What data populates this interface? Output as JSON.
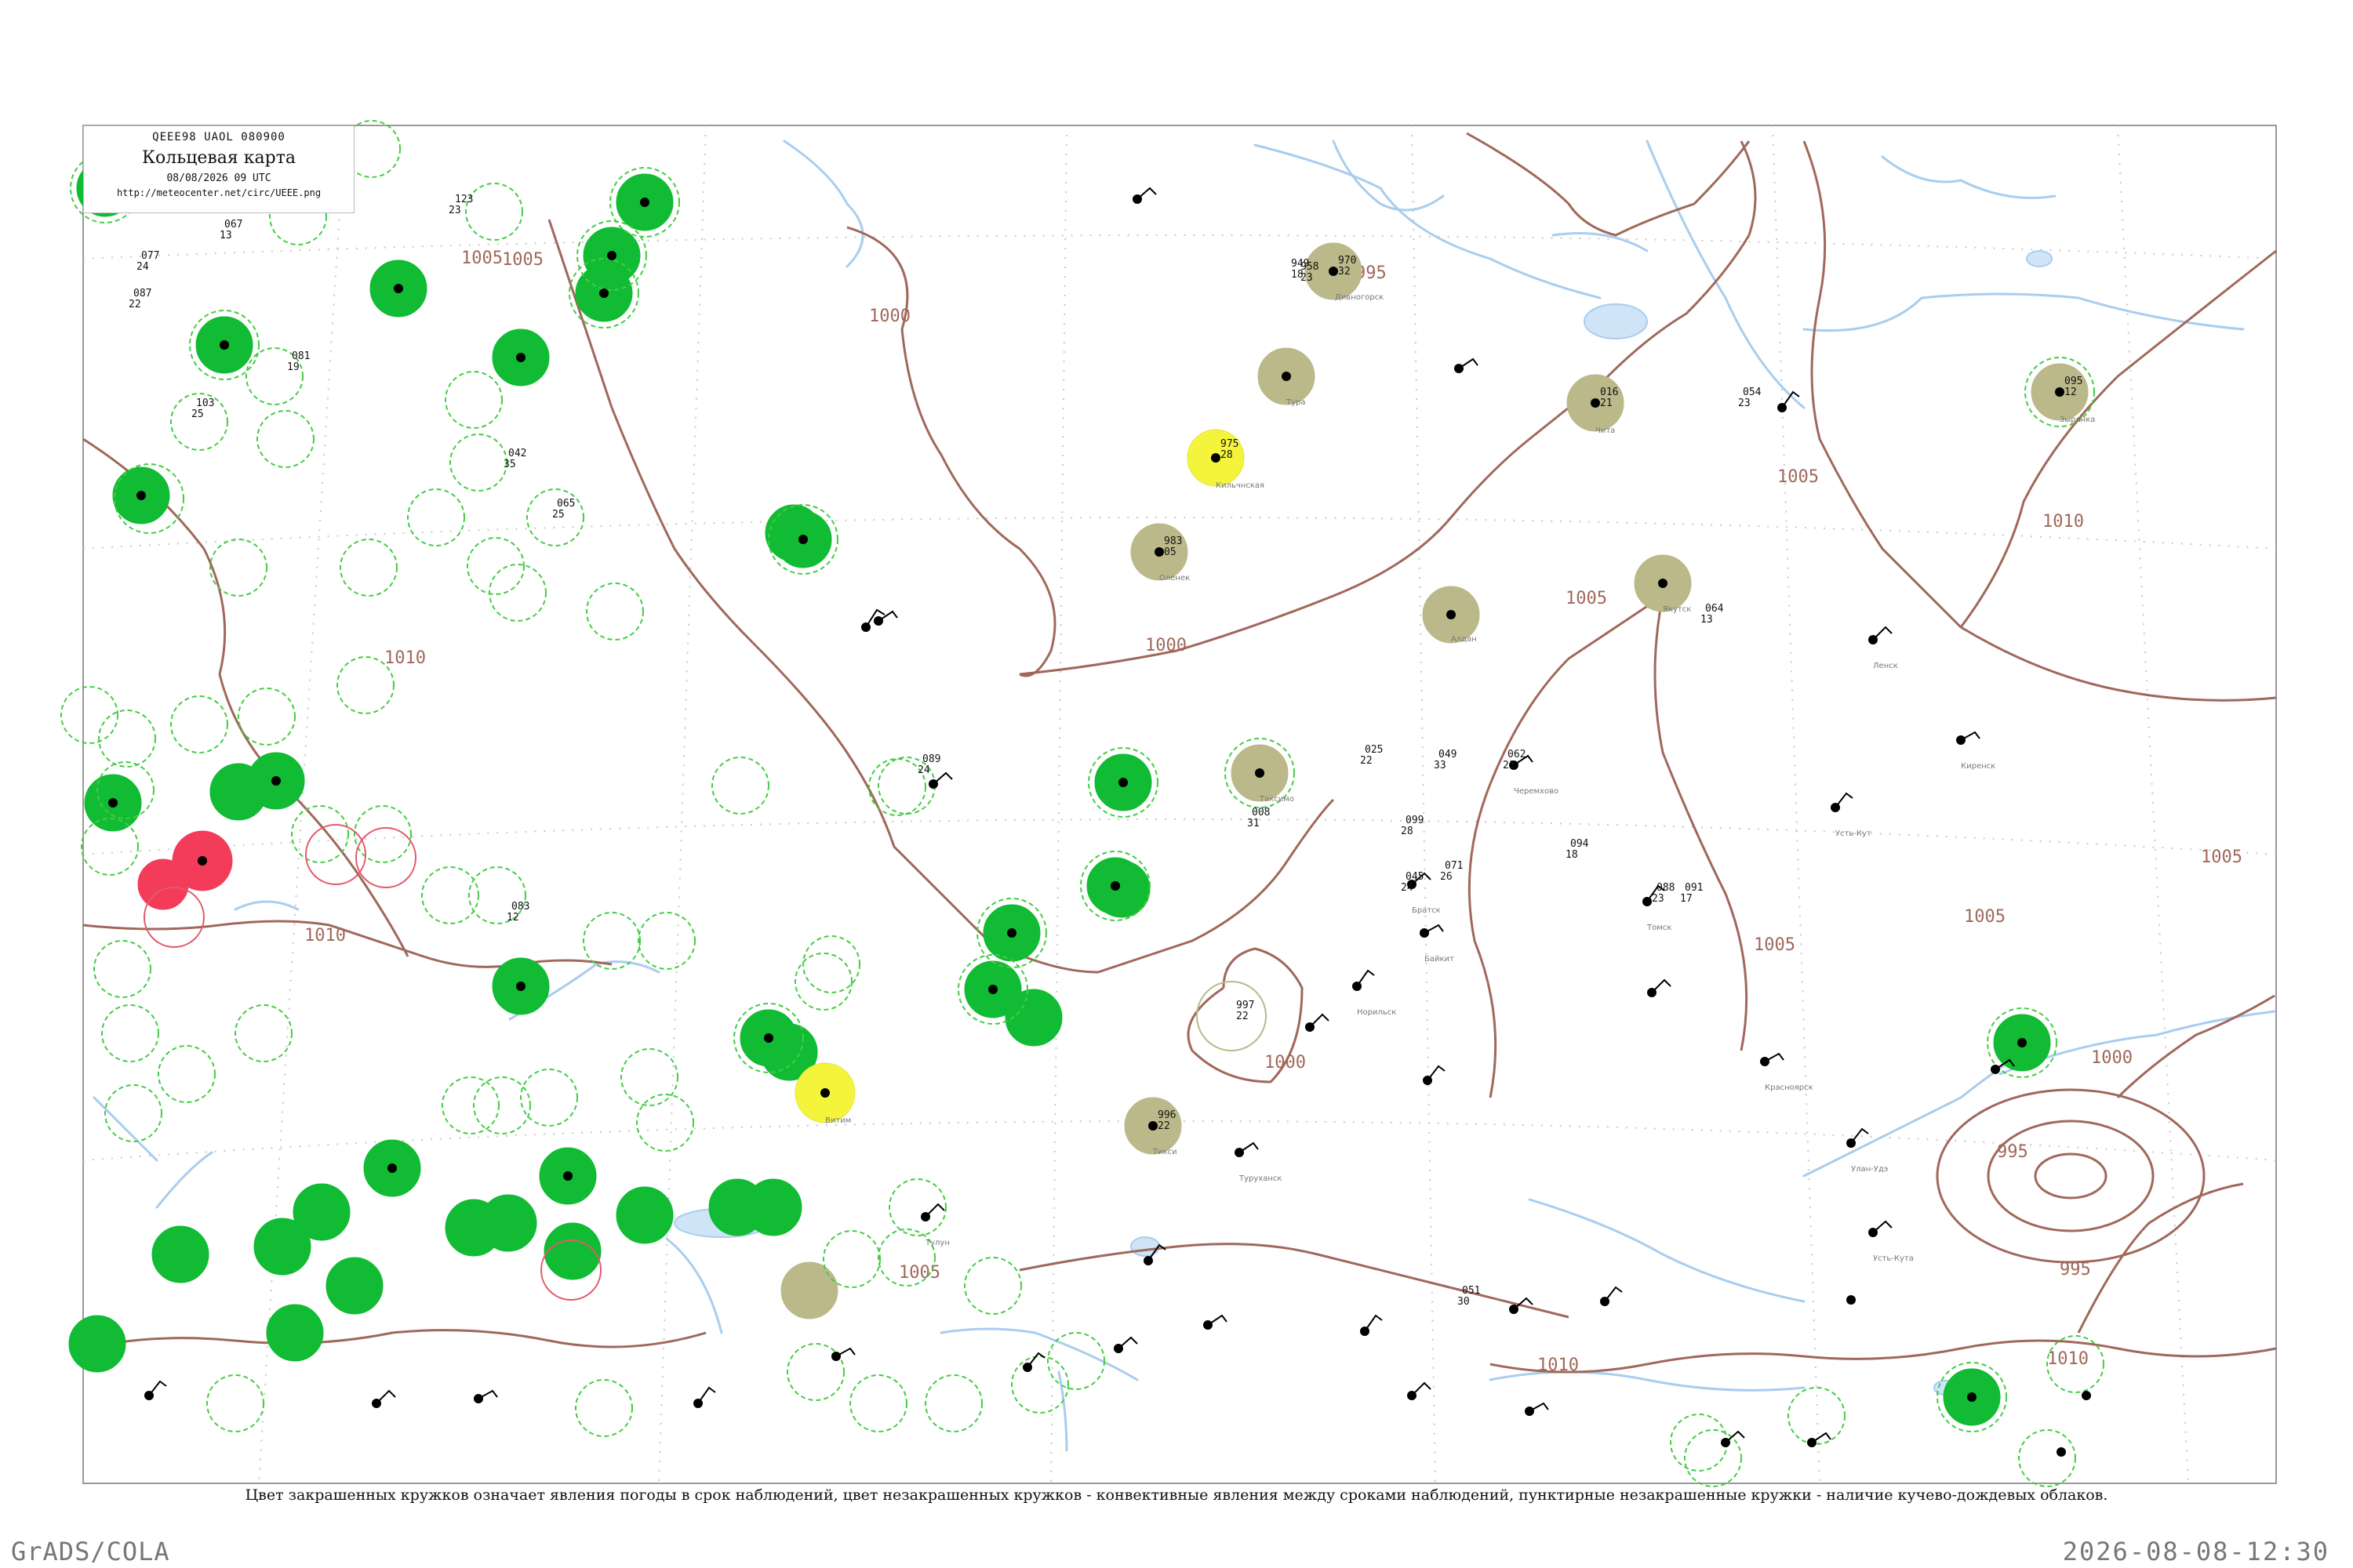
{
  "header": {
    "code": "QEEE98  UAOL  080900",
    "title": "Кольцевая карта",
    "date": "08/08/2026 09 UTC",
    "url": "http://meteocenter.net/circ/UEEE.png"
  },
  "caption": "Цвет закрашенных кружков означает явления погоды в срок наблюдений, цвет незакрашенных кружков - конвективные явления между сроками наблюдений, пунктирные незакрашенные кружки - наличие кучево-дождевых облаков.",
  "footer": {
    "left": "GrADS/COLA",
    "right": "2026-08-08-12:30"
  },
  "colors": {
    "rain": "#11bb33",
    "dust": "#bbb98a",
    "haze": "#f4f43c",
    "thunder": "#f23c5a",
    "isobar": "#a0685a",
    "river": "#a9cdef",
    "outline_dashed": "#44cc44"
  },
  "isobar_labels": [
    "1005",
    "1000",
    "995",
    "1010",
    "1000",
    "1005",
    "1010",
    "1005",
    "1010",
    "1005",
    "1000",
    "995",
    "1005",
    "1005",
    "1010",
    "1005",
    "1000",
    "1010",
    "995",
    "1005"
  ],
  "stations": [
    {
      "p": "123",
      "w": "23"
    },
    {
      "p": "087",
      "w": "22"
    },
    {
      "p": "081",
      "w": "19"
    },
    {
      "p": "103",
      "w": "25"
    },
    {
      "p": "067",
      "w": "13"
    },
    {
      "p": "077",
      "w": "24"
    },
    {
      "p": "094",
      "w": "18"
    },
    {
      "p": "088",
      "w": "23"
    },
    {
      "p": "091",
      "w": "17"
    },
    {
      "p": "042",
      "w": "35"
    },
    {
      "p": "051",
      "w": "30"
    },
    {
      "p": "065",
      "w": "25"
    },
    {
      "p": "083",
      "w": "12"
    },
    {
      "p": "064",
      "w": "13"
    },
    {
      "p": "099",
      "w": "28"
    },
    {
      "p": "071",
      "w": "26"
    },
    {
      "p": "049",
      "w": "33"
    },
    {
      "p": "089",
      "w": "24"
    },
    {
      "p": "970",
      "w": "32"
    },
    {
      "p": "975",
      "w": "28"
    },
    {
      "p": "983",
      "w": "05"
    },
    {
      "p": "949",
      "w": "18"
    },
    {
      "p": "958",
      "w": "23"
    },
    {
      "p": "095",
      "w": "12"
    },
    {
      "p": "062",
      "w": "21"
    },
    {
      "p": "045",
      "w": "24"
    },
    {
      "p": "016",
      "w": "21"
    },
    {
      "p": "054",
      "w": "23"
    },
    {
      "p": "025",
      "w": "22"
    },
    {
      "p": "008",
      "w": "31"
    },
    {
      "p": "996",
      "w": "22"
    },
    {
      "p": "997",
      "w": "22"
    }
  ],
  "city_labels": [
    "Дивногорск",
    "Тура",
    "Оленек",
    "Алдан",
    "Чита",
    "Якутск",
    "Таксимо",
    "Тикси",
    "Зырянка",
    "Кильчнская",
    "Витим",
    "Ленск",
    "Киренск",
    "Усть-Кут",
    "Братск",
    "Черемхово",
    "Томск",
    "Красноярск",
    "Улан-Удэ",
    "Усть-Кута",
    "Норильск",
    "Байкит",
    "Туруханск",
    "Тулун"
  ]
}
